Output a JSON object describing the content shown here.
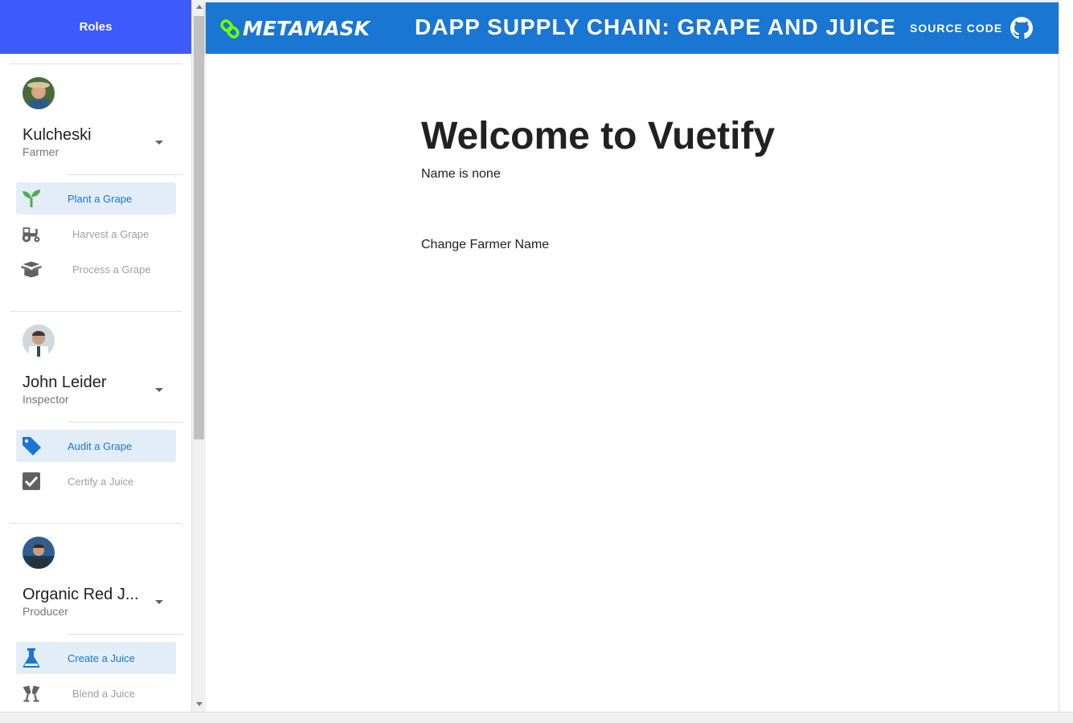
{
  "sidebar": {
    "header": "Roles",
    "roles": [
      {
        "name": "Kulcheski",
        "title": "Farmer",
        "actions": [
          {
            "label": "Plant a Grape",
            "icon": "sprout-icon",
            "active": true
          },
          {
            "label": "Harvest a Grape",
            "icon": "tractor-icon",
            "active": false
          },
          {
            "label": "Process a Grape",
            "icon": "box-open-icon",
            "active": false
          }
        ]
      },
      {
        "name": "John Leider",
        "title": "Inspector",
        "actions": [
          {
            "label": "Audit a Grape",
            "icon": "tag-icon",
            "active": true
          },
          {
            "label": "Certify a Juice",
            "icon": "checkbox-icon",
            "active": false
          }
        ]
      },
      {
        "name": "Organic Red J...",
        "title": "Producer",
        "actions": [
          {
            "label": "Create a Juice",
            "icon": "flask-icon",
            "active": true
          },
          {
            "label": "Blend a Juice",
            "icon": "glasses-cheers-icon",
            "active": false
          }
        ]
      }
    ]
  },
  "toolbar": {
    "logo": "METAMASK",
    "title": "DAPP SUPPLY CHAIN: GRAPE AND JUICE",
    "source_label": "SOURCE CODE"
  },
  "main": {
    "heading": "Welcome to Vuetify",
    "name_line": "Name is none",
    "change_name": "Change Farmer Name"
  },
  "colors": {
    "primary": "#1976d2",
    "sidebar_header": "#3d5afe",
    "active_bg": "#e3edf8",
    "logo_link": "#76ff03"
  }
}
